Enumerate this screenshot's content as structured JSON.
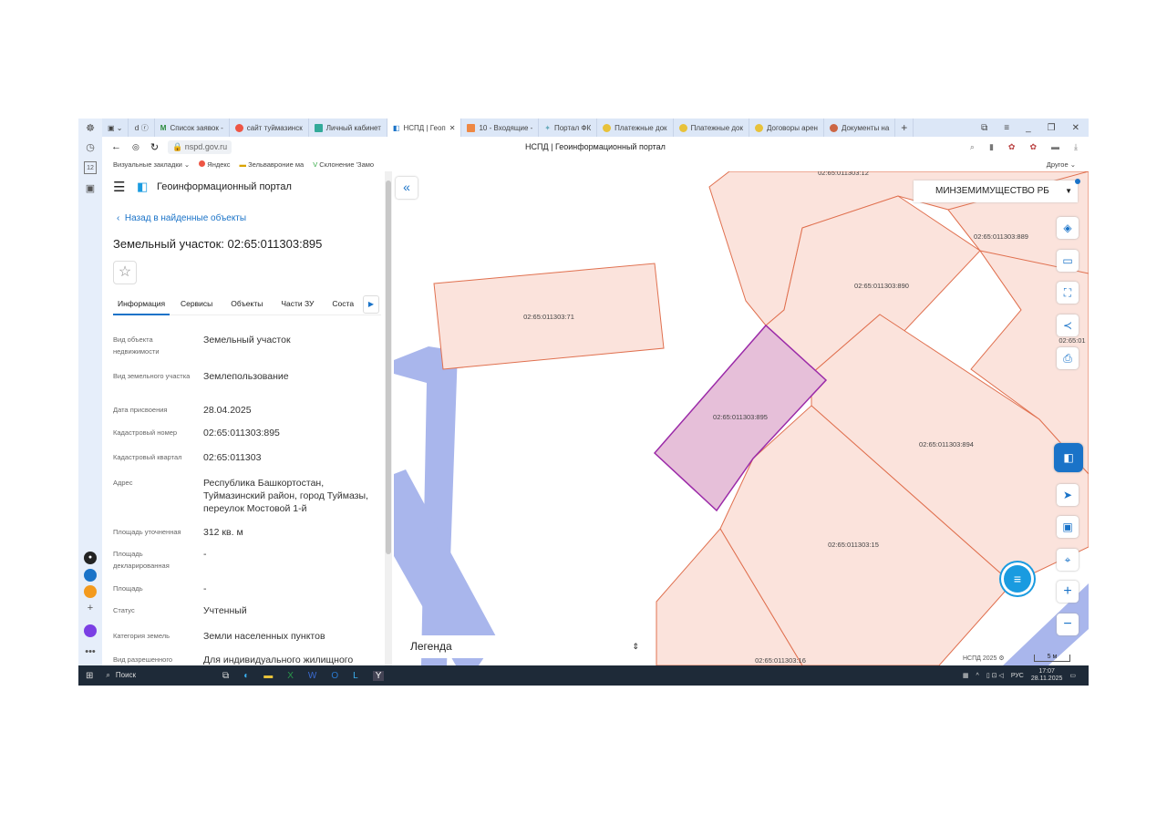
{
  "browser": {
    "tabs": [
      "Список заявок -",
      "сайт туймазинск",
      "Личный кабинет",
      "НСПД | Геоп",
      "10 - Входящие -",
      "Портал ФК",
      "Платежные док",
      "Платежные док",
      "Договоры арен",
      "Документы на"
    ],
    "active_tab": 3,
    "url": "nspd.gov.ru",
    "page_title": "НСПД | Геоинформационный портал",
    "bookmarks": [
      "Визуальные закладки",
      "Яндекс",
      "Зельвавроние ма",
      "Склонение 'Замо"
    ],
    "bookmarks_other": "Другое"
  },
  "portal": {
    "title": "Геоинформационный портал",
    "back_link": "Назад в найденные объекты",
    "object_title": "Земельный участок: 02:65:011303:895",
    "tabs": [
      "Информация",
      "Сервисы",
      "Объекты",
      "Части ЗУ",
      "Соста"
    ],
    "active_tab": "Информация",
    "fields": [
      {
        "k": "Вид объекта недвижимости",
        "v": "Земельный участок"
      },
      {
        "k": "Вид земельного участка",
        "v": "Землепользование"
      },
      {
        "k": "Дата присвоения",
        "v": "28.04.2025"
      },
      {
        "k": "Кадастровый номер",
        "v": "02:65:011303:895"
      },
      {
        "k": "Кадастровый квартал",
        "v": "02:65:011303"
      },
      {
        "k": "Адрес",
        "v": "Республика Башкортостан, Туймазинский район, город Туймазы, переулок Мостовой 1-й"
      },
      {
        "k": "Площадь уточненная",
        "v": "312 кв. м"
      },
      {
        "k": "Площадь декларированная",
        "v": "-"
      },
      {
        "k": "Площадь",
        "v": "-"
      },
      {
        "k": "Статус",
        "v": "Учтенный"
      },
      {
        "k": "Категория земель",
        "v": "Земли населенных пунктов"
      },
      {
        "k": "Вид разрешенного",
        "v": "Для индивидуального жилищного"
      }
    ]
  },
  "map": {
    "layer_select": "МИНЗЕМИМУЩЕСТВО РБ",
    "legend": "Легенда",
    "attribution": "НСПД 2025",
    "scale": "5 м",
    "labels": {
      "p12": "02:65:011303:12",
      "p889": "02:65:011303:889",
      "p890": "02:65:011303:890",
      "p71": "02:65:011303:71",
      "p895": "02:65:011303:895",
      "p894": "02:65:011303:894",
      "p15": "02:65:011303:15",
      "p16": "02:65:011303:16",
      "p01": "02:65:01"
    },
    "colors": {
      "parcel_fill": "#fbe3dc",
      "parcel_stroke": "#e0704f",
      "selected_fill": "#e6bfd9",
      "selected_stroke": "#9b2aa8",
      "road": "#a9b6ec",
      "accent": "#1a73c8"
    }
  },
  "taskbar": {
    "search": "Поиск",
    "lang": "РУС",
    "time": "17:07",
    "date": "28.11.2025"
  }
}
